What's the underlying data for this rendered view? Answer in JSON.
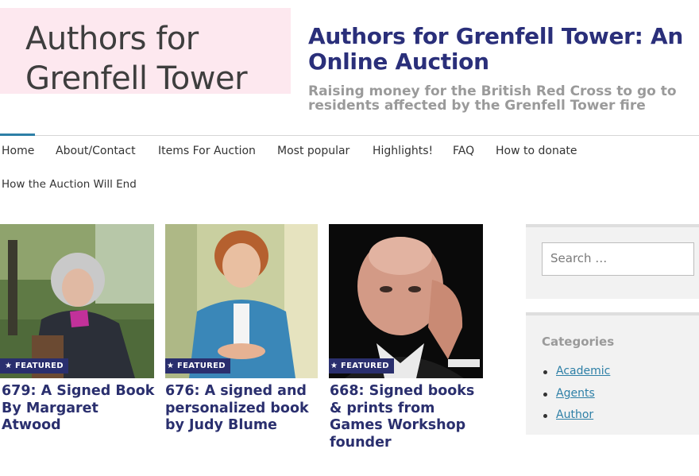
{
  "header": {
    "logo_line1": "Authors for",
    "logo_line2": "Grenfell Tower",
    "site_title": "Authors for Grenfell Tower: An Online Auction",
    "tagline": "Raising money for the British Red Cross to go to residents affected by the Grenfell Tower fire"
  },
  "nav": {
    "items": [
      "Home",
      "About/Contact",
      "Items For Auction",
      "Most popular",
      "Highlights!",
      "FAQ",
      "How to donate",
      "How the Auction Will End"
    ]
  },
  "posts": [
    {
      "badge": "★ FEATURED",
      "title": "679: A Signed Book By Margaret Atwood"
    },
    {
      "badge": "★ FEATURED",
      "title": "676: A signed and personalized book by Judy Blume"
    },
    {
      "badge": "★ FEATURED",
      "title": "668: Signed books & prints from Games Workshop founder"
    }
  ],
  "sidebar": {
    "search_placeholder": "Search …",
    "categories_title": "Categories",
    "categories": [
      "Academic",
      "Agents",
      "Author"
    ]
  },
  "colors": {
    "accent": "#2a2f6e",
    "link": "#2d7fa6",
    "logo_bg": "#fde8ef"
  }
}
